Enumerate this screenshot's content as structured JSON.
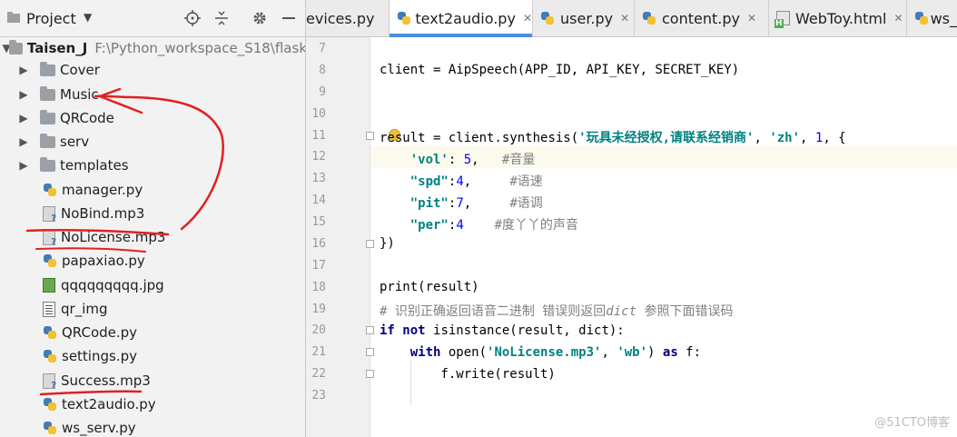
{
  "project_panel": {
    "title": "Project",
    "root": {
      "name": "Taisen_J",
      "path": "F:\\Python_workspace_S18\\flask"
    },
    "items": [
      {
        "label": "Cover",
        "type": "folder"
      },
      {
        "label": "Music",
        "type": "folder"
      },
      {
        "label": "QRCode",
        "type": "folder"
      },
      {
        "label": "serv",
        "type": "folder"
      },
      {
        "label": "templates",
        "type": "folder"
      },
      {
        "label": "manager.py",
        "type": "python"
      },
      {
        "label": "NoBind.mp3",
        "type": "unknown"
      },
      {
        "label": "NoLicense.mp3",
        "type": "unknown"
      },
      {
        "label": "papaxiao.py",
        "type": "python"
      },
      {
        "label": "qqqqqqqqq.jpg",
        "type": "image"
      },
      {
        "label": "qr_img",
        "type": "plain"
      },
      {
        "label": "QRCode.py",
        "type": "python"
      },
      {
        "label": "settings.py",
        "type": "python"
      },
      {
        "label": "Success.mp3",
        "type": "unknown"
      },
      {
        "label": "text2audio.py",
        "type": "python"
      },
      {
        "label": "ws_serv.py",
        "type": "python"
      }
    ]
  },
  "tabs": [
    {
      "label": "evices.py",
      "active": false
    },
    {
      "label": "text2audio.py",
      "active": true
    },
    {
      "label": "user.py",
      "active": false
    },
    {
      "label": "content.py",
      "active": false
    },
    {
      "label": "WebToy.html",
      "active": false
    },
    {
      "label": "ws_",
      "active": false
    }
  ],
  "editor": {
    "line_numbers": [
      "7",
      "8",
      "9",
      "10",
      "11",
      "12",
      "13",
      "14",
      "15",
      "16",
      "17",
      "18",
      "19",
      "20",
      "21",
      "22",
      "23"
    ],
    "current_line": "12",
    "tokens": {
      "l8": "client = AipSpeech(APP_ID, API_KEY, SECRET_KEY)",
      "l11_a": "result",
      "l11_b": " = client.synthesis(",
      "l11_c": "'玩具未经授权,请联系经销商'",
      "l11_d": ", ",
      "l11_e": "'zh'",
      "l11_f": ", ",
      "l11_g": "1",
      "l11_h": ", {",
      "l12_a": "    ",
      "l12_b": "'vol'",
      "l12_c": ": ",
      "l12_d": "5",
      "l12_e": ",   ",
      "l12_f": "#音量",
      "l13_a": "    ",
      "l13_b": "\"spd\"",
      "l13_c": ":",
      "l13_d": "4",
      "l13_e": ",     ",
      "l13_f": "#语速",
      "l14_a": "    ",
      "l14_b": "\"pit\"",
      "l14_c": ":",
      "l14_d": "7",
      "l14_e": ",     ",
      "l14_f": "#语调",
      "l15_a": "    ",
      "l15_b": "\"per\"",
      "l15_c": ":",
      "l15_d": "4",
      "l15_e": "    ",
      "l15_f": "#度丫丫的声音",
      "l16": "})",
      "l19": "print(result)",
      "l20_a": "# 识别正确返回语音二进制 错误则返回",
      "l20_b": "dict",
      "l20_c": " 参照下面错误码",
      "l21_a": "if",
      "l21_b": " ",
      "l21_c": "not",
      "l21_d": " isinstance(result, dict):",
      "l22_a": "    ",
      "l22_b": "with",
      "l22_c": " open(",
      "l22_d": "'NoLicense.mp3'",
      "l22_e": ", ",
      "l22_f": "'wb'",
      "l22_g": ") ",
      "l22_h": "as",
      "l22_i": " f:",
      "l23": "        f.write(result)"
    }
  },
  "watermark": "@51CTO博客",
  "colors": {
    "accent": "#4a8ee0",
    "annotation": "#e02020"
  }
}
